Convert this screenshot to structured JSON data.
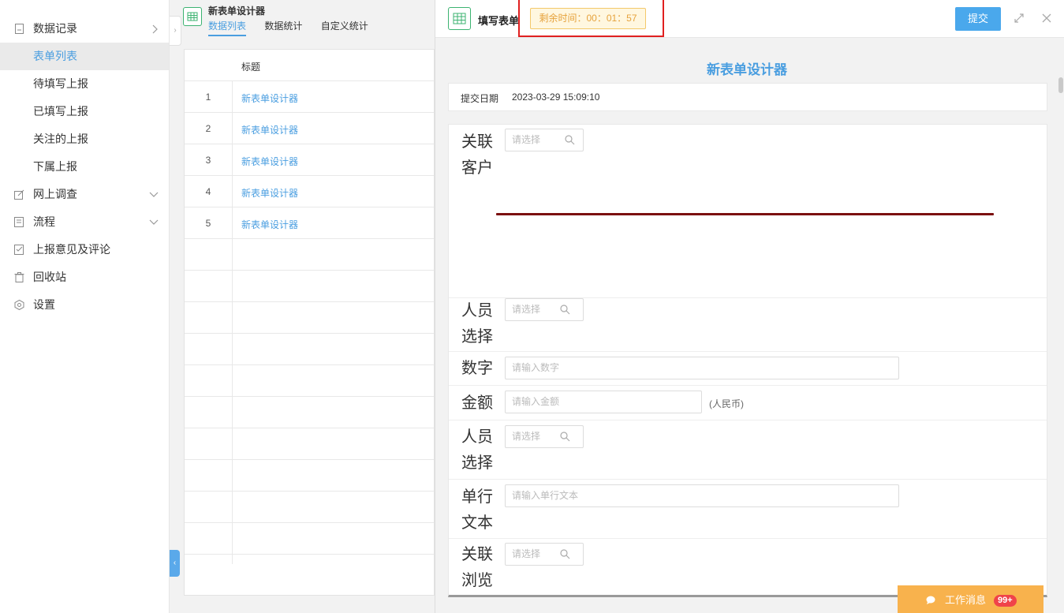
{
  "sidebar": {
    "items": [
      {
        "label": "数据记录",
        "icon": "document-icon",
        "arrow": "right"
      },
      {
        "label": "表单列表",
        "active": true
      },
      {
        "label": "待填写上报"
      },
      {
        "label": "已填写上报"
      },
      {
        "label": "关注的上报"
      },
      {
        "label": "下属上报"
      },
      {
        "label": "网上调查",
        "icon": "edit-icon",
        "arrow": "down"
      },
      {
        "label": "流程",
        "icon": "flow-icon",
        "arrow": "down"
      },
      {
        "label": "上报意见及评论",
        "icon": "comment-icon"
      },
      {
        "label": "回收站",
        "icon": "trash-icon"
      },
      {
        "label": "设置",
        "icon": "gear-icon"
      }
    ]
  },
  "middle": {
    "title": "新表单设计器",
    "tabs": [
      "数据列表",
      "数据统计",
      "自定义统计"
    ],
    "table": {
      "header": "标题",
      "rows": [
        {
          "num": "1",
          "title": "新表单设计器"
        },
        {
          "num": "2",
          "title": "新表单设计器"
        },
        {
          "num": "3",
          "title": "新表单设计器"
        },
        {
          "num": "4",
          "title": "新表单设计器"
        },
        {
          "num": "5",
          "title": "新表单设计器"
        }
      ]
    }
  },
  "panel": {
    "title": "填写表单",
    "timer": "剩余时间：00：01：57",
    "submit": "提交",
    "form_title": "新表单设计器",
    "date_label": "提交日期",
    "date_value": "2023-03-29 15:09:10",
    "fields": {
      "customer": {
        "label": "关联客户",
        "placeholder": "请选择"
      },
      "person1": {
        "label": "人员选择",
        "placeholder": "请选择"
      },
      "number": {
        "label": "数字",
        "placeholder": "请输入数字"
      },
      "amount": {
        "label": "金额",
        "placeholder": "请输入金额",
        "unit": "(人民币)"
      },
      "person2": {
        "label": "人员选择",
        "placeholder": "请选择"
      },
      "text": {
        "label": "单行文本",
        "placeholder": "请输入单行文本"
      },
      "browse": {
        "label": "关联浏览",
        "placeholder": "请选择"
      }
    }
  },
  "messages": {
    "label": "工作消息",
    "badge": "99+"
  },
  "colors": {
    "accent": "#4a9ee0",
    "timer_bg": "#fff7e0",
    "timer_text": "#e6a23c",
    "highlight_box": "#e02020",
    "message_bg": "#f8b24d",
    "badge": "#f0434a"
  }
}
